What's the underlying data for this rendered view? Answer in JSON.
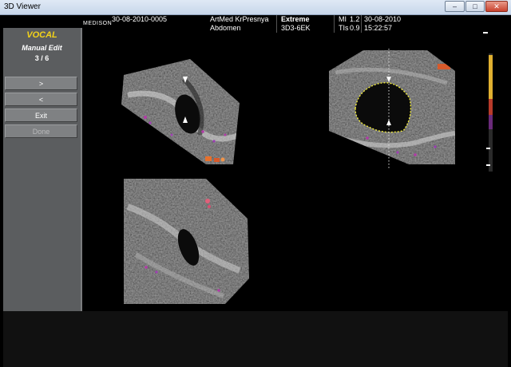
{
  "window": {
    "title": "3D Viewer"
  },
  "header": {
    "logo": "MEDISON",
    "study_id": "30-08-2010-0005",
    "institution": "ArtMed KrPresnya",
    "exam": "Abdomen",
    "mode": "Extreme",
    "probe": "3D3-6EK",
    "mi_label": "MI",
    "mi_value": "1.2",
    "tis_label": "TIs",
    "tis_value": "0.9",
    "date": "30-08-2010",
    "time": "15:22:57"
  },
  "panel": {
    "title": "VOCAL",
    "subtitle": "Manual Edit",
    "counter": "3 / 6",
    "buttons": [
      ">",
      "<",
      "Exit",
      "Done"
    ]
  },
  "colors": {
    "accent": "#f2d21a",
    "panel_bg": "#5b5d5f",
    "button_bg": "#7f8183",
    "contour": "#f0ea3a"
  }
}
